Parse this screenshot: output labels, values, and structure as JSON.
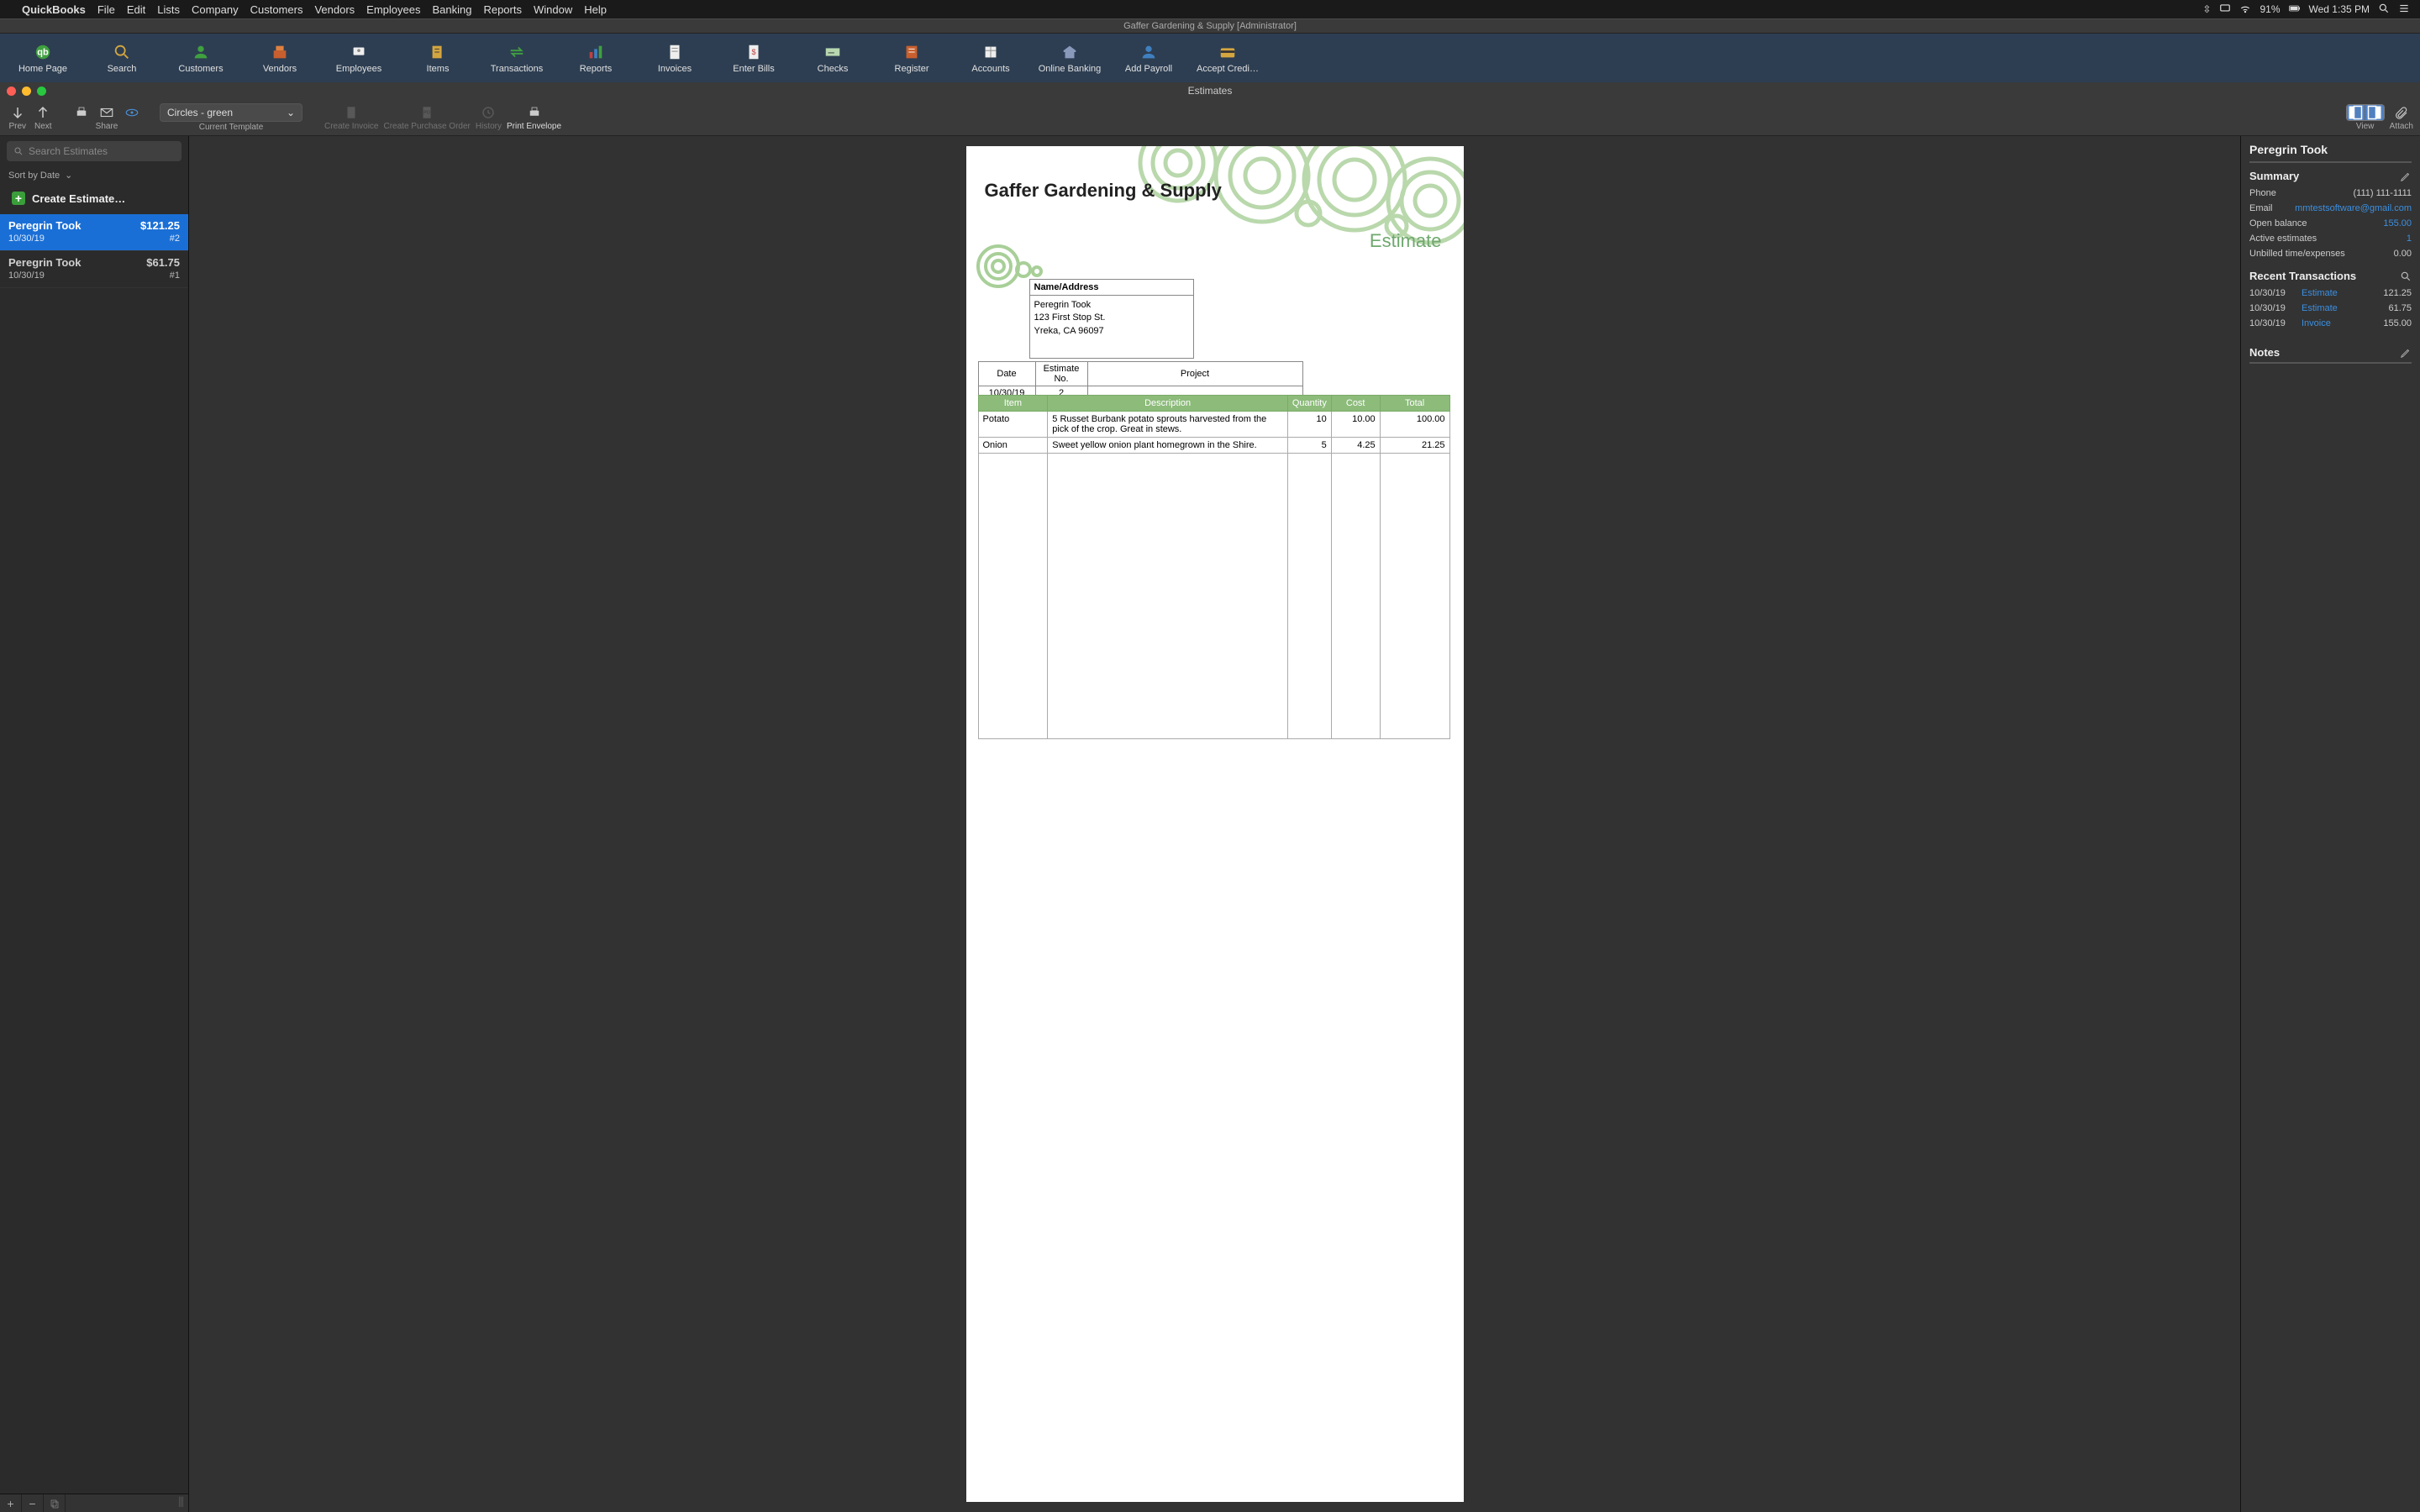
{
  "mac_menu": {
    "app_name": "QuickBooks",
    "items": [
      "File",
      "Edit",
      "Lists",
      "Company",
      "Customers",
      "Vendors",
      "Employees",
      "Banking",
      "Reports",
      "Window",
      "Help"
    ],
    "battery_pct": "91%",
    "clock": "Wed 1:35 PM"
  },
  "window_title": "Gaffer Gardening & Supply [Administrator]",
  "main_toolbar": [
    {
      "label": "Home Page"
    },
    {
      "label": "Search"
    },
    {
      "label": "Customers"
    },
    {
      "label": "Vendors"
    },
    {
      "label": "Employees"
    },
    {
      "label": "Items"
    },
    {
      "label": "Transactions"
    },
    {
      "label": "Reports"
    },
    {
      "label": "Invoices"
    },
    {
      "label": "Enter Bills"
    },
    {
      "label": "Checks"
    },
    {
      "label": "Register"
    },
    {
      "label": "Accounts"
    },
    {
      "label": "Online Banking"
    },
    {
      "label": "Add Payroll"
    },
    {
      "label": "Accept Credi…"
    }
  ],
  "estimates_window_title": "Estimates",
  "sec_toolbar": {
    "prev": "Prev",
    "next": "Next",
    "share": "Share",
    "template_selected": "Circles - green",
    "template_label": "Current Template",
    "create_invoice": "Create Invoice",
    "create_po": "Create Purchase Order",
    "history": "History",
    "print_envelope": "Print Envelope",
    "view": "View",
    "attach": "Attach"
  },
  "sidebar": {
    "search_placeholder": "Search Estimates",
    "sort_label": "Sort by Date",
    "create_label": "Create Estimate…",
    "items": [
      {
        "name": "Peregrin Took",
        "amount": "$121.25",
        "date": "10/30/19",
        "num": "#2",
        "selected": true
      },
      {
        "name": "Peregrin Took",
        "amount": "$61.75",
        "date": "10/30/19",
        "num": "#1",
        "selected": false
      }
    ]
  },
  "document": {
    "company": "Gaffer Gardening & Supply",
    "title": "Estimate",
    "name_address_label": "Name/Address",
    "address_lines": [
      "Peregrin Took",
      "123 First Stop St.",
      "Yreka, CA 96097"
    ],
    "meta_headers": [
      "Date",
      "Estimate No.",
      "Project"
    ],
    "meta_values": [
      "10/30/19",
      "2",
      ""
    ],
    "line_headers": [
      "Item",
      "Description",
      "Quantity",
      "Cost",
      "Total"
    ],
    "lines": [
      {
        "item": "Potato",
        "desc": "5 Russet Burbank potato sprouts harvested from the pick of the crop. Great in stews.",
        "qty": "10",
        "cost": "10.00",
        "total": "100.00"
      },
      {
        "item": "Onion",
        "desc": "Sweet yellow onion plant homegrown in the Shire.",
        "qty": "5",
        "cost": "4.25",
        "total": "21.25"
      }
    ]
  },
  "info": {
    "customer": "Peregrin Took",
    "summary_label": "Summary",
    "fields": {
      "phone_label": "Phone",
      "phone": "(111) 111-1111",
      "email_label": "Email",
      "email": "mmtestsoftware@gmail.com",
      "open_balance_label": "Open balance",
      "open_balance": "155.00",
      "active_est_label": "Active estimates",
      "active_est": "1",
      "unbilled_label": "Unbilled time/expenses",
      "unbilled": "0.00"
    },
    "recent_label": "Recent Transactions",
    "recent": [
      {
        "date": "10/30/19",
        "type": "Estimate",
        "amount": "121.25"
      },
      {
        "date": "10/30/19",
        "type": "Estimate",
        "amount": "61.75"
      },
      {
        "date": "10/30/19",
        "type": "Invoice",
        "amount": "155.00"
      }
    ],
    "notes_label": "Notes"
  }
}
